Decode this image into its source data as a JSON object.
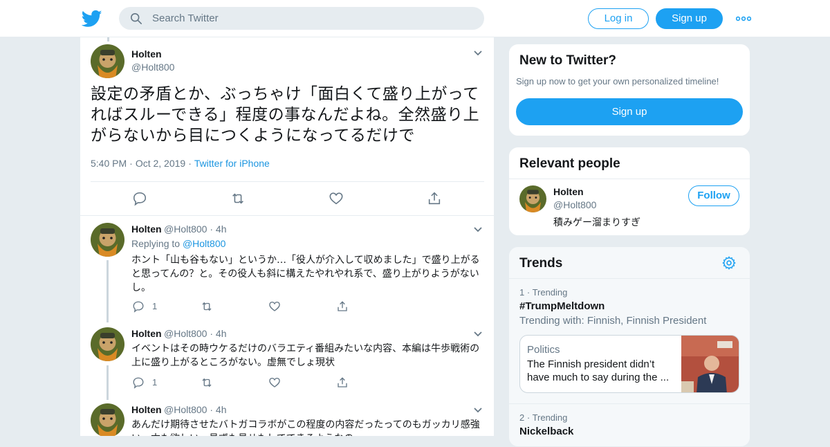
{
  "topbar": {
    "search_placeholder": "Search Twitter",
    "login_label": "Log in",
    "signup_label": "Sign up",
    "logo_icon": "twitter-bird-icon",
    "more_icon": "more-dots-icon"
  },
  "main_tweet": {
    "name": "Holten",
    "handle": "@Holt800",
    "text": "設定の矛盾とか、ぶっちゃけ「面白くて盛り上がってればスルーできる」程度の事なんだよね。全然盛り上がらないから目につくようになってるだけで",
    "time": "5:40 PM",
    "date": "Oct 2, 2019",
    "source": "Twitter for iPhone"
  },
  "replies": [
    {
      "name": "Holten",
      "handle": "@Holt800",
      "time": "4h",
      "replying_prefix": "Replying to",
      "replying_to": "@Holt800",
      "text": "ホント「山も谷もない」というか…「役人が介入して収めました」で盛り上がると思ってんの？と。その役人も斜に構えたやれやれ系で、盛り上がりようがないし。",
      "reply_count": "1"
    },
    {
      "name": "Holten",
      "handle": "@Holt800",
      "time": "4h",
      "text": "イベントはその時ウケるだけのバラエティ番組みたいな内容、本編は牛歩戦術の上に盛り上がるところがない。虚無でしょ現状",
      "reply_count": "1"
    },
    {
      "name": "Holten",
      "handle": "@Holt800",
      "time": "4h",
      "text": "あんだけ期待させたバトガコラボがこの程度の内容だったってのもガッカリ感強い…本も欲しい、見ずも見せもしてできるようなの…"
    }
  ],
  "new_to_twitter": {
    "title": "New to Twitter?",
    "subtitle": "Sign up now to get your own personalized timeline!",
    "signup_label": "Sign up"
  },
  "relevant_people": {
    "title": "Relevant people",
    "name": "Holten",
    "handle": "@Holt800",
    "bio": "積みゲー溜まりすぎ",
    "follow_label": "Follow"
  },
  "trends": {
    "title": "Trends",
    "items": [
      {
        "rank": "1",
        "label": "Trending",
        "name": "#TrumpMeltdown",
        "with": "Trending with: Finnish, Finnish President",
        "news_category": "Politics",
        "news_text": "The Finnish president didn’t have much to say during the ..."
      },
      {
        "rank": "2",
        "label": "Trending",
        "name": "Nickelback"
      }
    ]
  },
  "colors": {
    "accent": "#1da1f2",
    "link": "#1b95e0",
    "muted": "#657786",
    "border": "#e6ecf0",
    "thread": "#ccd6dd"
  }
}
